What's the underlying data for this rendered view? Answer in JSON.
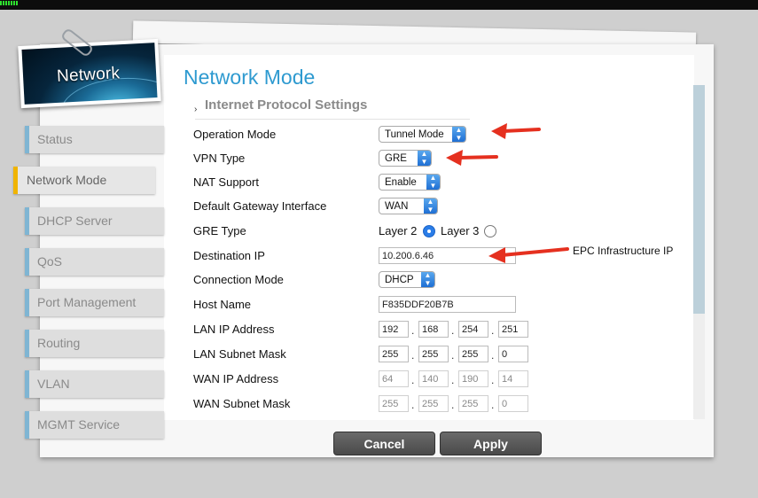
{
  "header": {
    "section": "Network",
    "title": "Network Mode",
    "subsection": "Internet Protocol Settings"
  },
  "sidebar": {
    "items": [
      {
        "label": "Status"
      },
      {
        "label": "Network Mode"
      },
      {
        "label": "DHCP Server"
      },
      {
        "label": "QoS"
      },
      {
        "label": "Port Management"
      },
      {
        "label": "Routing"
      },
      {
        "label": "VLAN"
      },
      {
        "label": "MGMT Service"
      }
    ]
  },
  "form": {
    "operation_mode": {
      "label": "Operation Mode",
      "value": "Tunnel Mode"
    },
    "vpn_type": {
      "label": "VPN Type",
      "value": "GRE"
    },
    "nat_support": {
      "label": "NAT Support",
      "value": "Enable"
    },
    "default_gateway": {
      "label": "Default Gateway Interface",
      "value": "WAN"
    },
    "gre_type": {
      "label": "GRE Type",
      "option1": "Layer 2",
      "option2": "Layer 3",
      "selected": "Layer 2"
    },
    "destination_ip": {
      "label": "Destination IP",
      "value": "10.200.6.46"
    },
    "connection_mode": {
      "label": "Connection Mode",
      "value": "DHCP"
    },
    "host_name": {
      "label": "Host Name",
      "value": "F835DDF20B7B"
    },
    "lan_ip": {
      "label": "LAN IP Address",
      "o1": "192",
      "o2": "168",
      "o3": "254",
      "o4": "251"
    },
    "lan_mask": {
      "label": "LAN Subnet Mask",
      "o1": "255",
      "o2": "255",
      "o3": "255",
      "o4": "0"
    },
    "wan_ip": {
      "label": "WAN IP Address",
      "o1": "64",
      "o2": "140",
      "o3": "190",
      "o4": "14"
    },
    "wan_mask": {
      "label": "WAN Subnet Mask",
      "o1": "255",
      "o2": "255",
      "o3": "255",
      "o4": "0"
    }
  },
  "annotation": {
    "text": "EPC Infrastructure IP"
  },
  "buttons": {
    "cancel": "Cancel",
    "apply": "Apply"
  },
  "colors": {
    "accent": "#2e9ad0",
    "annotation_arrow": "#e5301f",
    "active_marker": "#f0b400"
  }
}
